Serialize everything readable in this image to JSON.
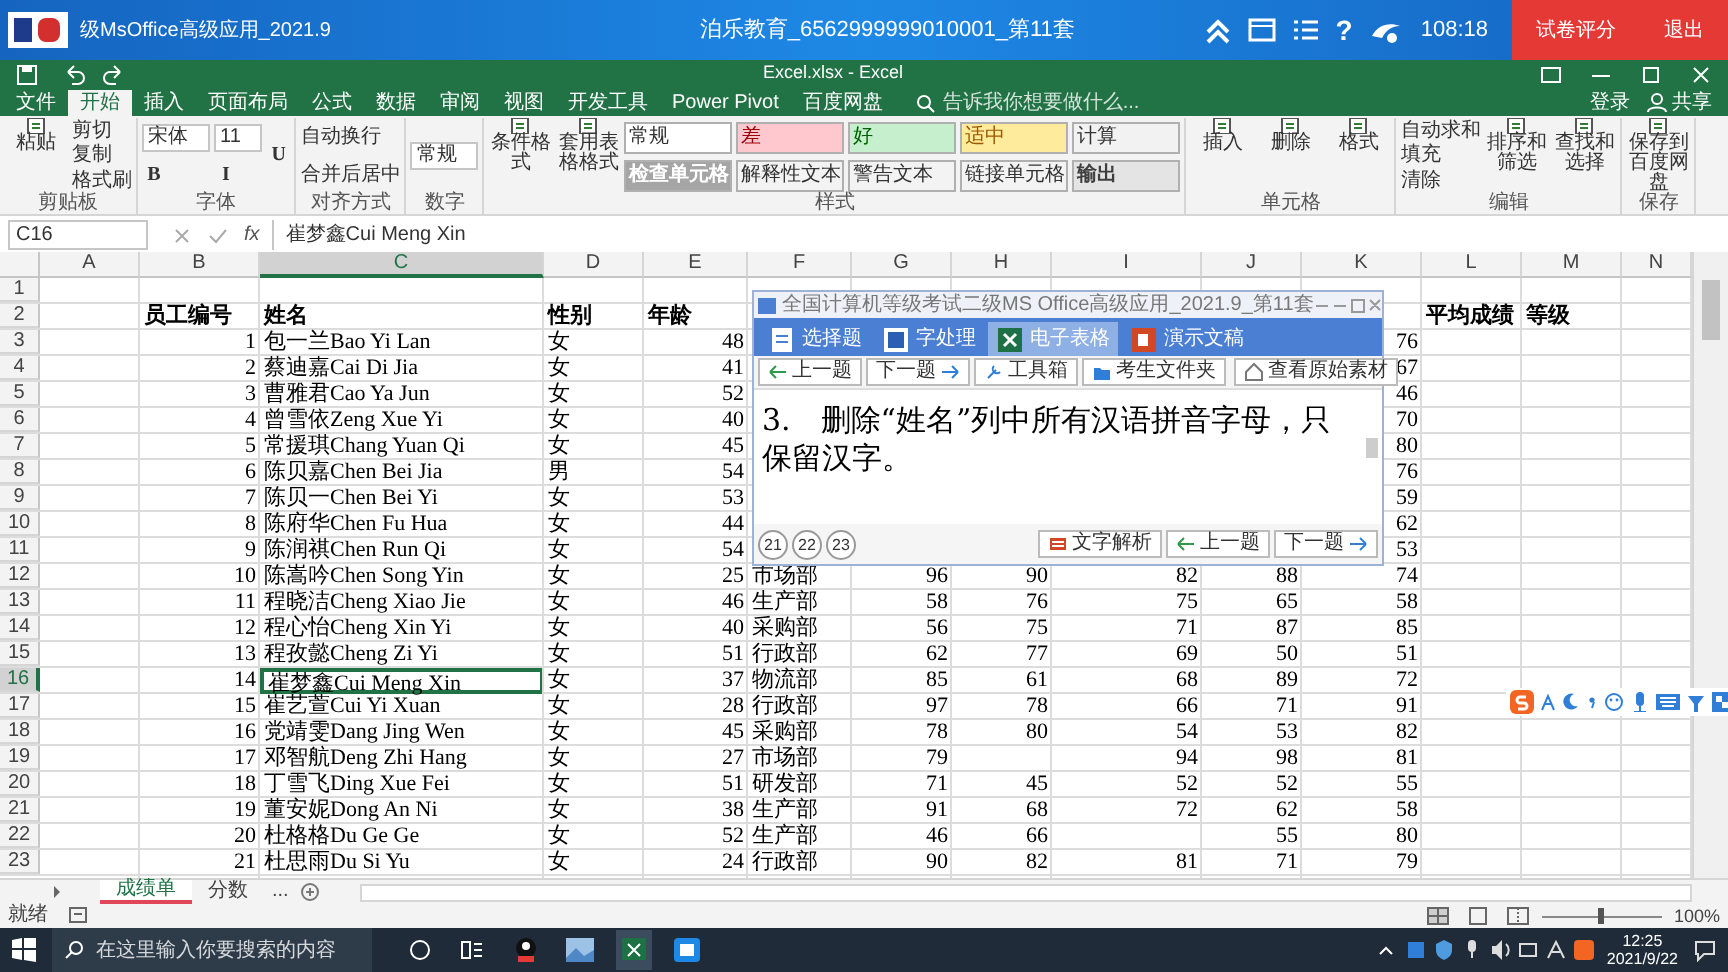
{
  "exam_bar": {
    "title": "级MsOffice高级应用_2021.9",
    "center": "泊乐教育_6562999999010001_第11套",
    "help": "?",
    "timer": "108:18",
    "buttons": [
      "试卷评分",
      "退出"
    ]
  },
  "excel_title": "Excel.xlsx - Excel",
  "ribbon_tabs": [
    {
      "label": "文件",
      "selected": false
    },
    {
      "label": "开始",
      "selected": true
    },
    {
      "label": "插入",
      "selected": false
    },
    {
      "label": "页面布局",
      "selected": false
    },
    {
      "label": "公式",
      "selected": false
    },
    {
      "label": "数据",
      "selected": false
    },
    {
      "label": "审阅",
      "selected": false
    },
    {
      "label": "视图",
      "selected": false
    },
    {
      "label": "开发工具",
      "selected": false
    },
    {
      "label": "Power Pivot",
      "selected": false
    },
    {
      "label": "百度网盘",
      "selected": false
    }
  ],
  "tell_me": "告诉我你想要做什么...",
  "account": [
    "登录",
    "共享"
  ],
  "ribbon_groups": [
    {
      "label": "剪贴板",
      "columns": [
        [
          {
            "kind": "large",
            "text": "粘贴"
          }
        ],
        [
          {
            "kind": "small",
            "text": "剪切"
          },
          {
            "kind": "small",
            "text": "复制"
          },
          {
            "kind": "small",
            "text": "格式刷"
          }
        ]
      ]
    },
    {
      "label": "字体",
      "columns": [
        [
          {
            "kind": "field",
            "text": "宋体"
          },
          {
            "kind": "glyph",
            "text": "B"
          }
        ],
        [
          {
            "kind": "field",
            "text": "11"
          },
          {
            "kind": "glyph",
            "text": "I"
          }
        ],
        [
          {
            "kind": "glyph",
            "text": "U"
          }
        ]
      ]
    },
    {
      "label": "对齐方式",
      "columns": [
        [
          {
            "kind": "small",
            "text": "自动换行"
          },
          {
            "kind": "small",
            "text": "合并后居中"
          }
        ]
      ]
    },
    {
      "label": "数字",
      "columns": [
        [
          {
            "kind": "field",
            "text": "常规"
          }
        ]
      ]
    },
    {
      "label": "样式",
      "columns": [
        [
          {
            "kind": "large",
            "text": "条件格式"
          }
        ],
        [
          {
            "kind": "large",
            "text": "套用表格格式"
          }
        ],
        [
          {
            "kind": "style",
            "text": "常规",
            "color": "#ffffff"
          },
          {
            "kind": "style",
            "text": "检查单元格",
            "color": "#a5a5a5"
          }
        ],
        [
          {
            "kind": "style",
            "text": "差",
            "color": "#ffc7ce"
          },
          {
            "kind": "style",
            "text": "解释性文本",
            "color": "#f3f3f3"
          }
        ],
        [
          {
            "kind": "style",
            "text": "好",
            "color": "#c6efce"
          },
          {
            "kind": "style",
            "text": "警告文本",
            "color": "#f3f3f3"
          }
        ],
        [
          {
            "kind": "style",
            "text": "适中",
            "color": "#ffeb9c"
          },
          {
            "kind": "style",
            "text": "链接单元格",
            "color": "#f3f3f3"
          }
        ],
        [
          {
            "kind": "style",
            "text": "计算",
            "color": "#f2f2f2"
          },
          {
            "kind": "style",
            "text": "输出",
            "color": "#e4e4e4"
          }
        ]
      ]
    },
    {
      "label": "单元格",
      "columns": [
        [
          {
            "kind": "large",
            "text": "插入"
          }
        ],
        [
          {
            "kind": "large",
            "text": "删除"
          }
        ],
        [
          {
            "kind": "large",
            "text": "格式"
          }
        ]
      ]
    },
    {
      "label": "编辑",
      "columns": [
        [
          {
            "kind": "small",
            "text": "自动求和"
          },
          {
            "kind": "small",
            "text": "填充"
          },
          {
            "kind": "small",
            "text": "清除"
          }
        ],
        [
          {
            "kind": "large",
            "text": "排序和筛选"
          }
        ],
        [
          {
            "kind": "large",
            "text": "查找和选择"
          }
        ]
      ]
    },
    {
      "label": "保存",
      "columns": [
        [
          {
            "kind": "large",
            "text": "保存到百度网盘"
          }
        ]
      ]
    }
  ],
  "formula_bar": {
    "name_box": "C16",
    "fx": "fx",
    "formula": "崔梦鑫Cui Meng Xin"
  },
  "columns": [
    {
      "label": "A",
      "selected": false
    },
    {
      "label": "B",
      "selected": false
    },
    {
      "label": "C",
      "selected": true
    },
    {
      "label": "D",
      "selected": false
    },
    {
      "label": "E",
      "selected": false
    },
    {
      "label": "F",
      "selected": false
    },
    {
      "label": "G",
      "selected": false
    },
    {
      "label": "H",
      "selected": false
    },
    {
      "label": "I",
      "selected": false
    },
    {
      "label": "J",
      "selected": false
    },
    {
      "label": "K",
      "selected": false
    },
    {
      "label": "L",
      "selected": false
    },
    {
      "label": "M",
      "selected": false
    },
    {
      "label": "N",
      "selected": false
    }
  ],
  "rows": [
    {
      "row": "1",
      "kind": "data",
      "selected": false
    },
    {
      "row": "2",
      "kind": "header",
      "selected": false,
      "B": "员工编号",
      "C": "姓名",
      "D": "性别",
      "E": "年龄",
      "L": "平均成绩",
      "M": "等级"
    },
    {
      "row": "3",
      "kind": "data",
      "selected": false,
      "B": "1",
      "C": "包一兰Bao Yi Lan",
      "D": "女",
      "E": "48",
      "K": "76"
    },
    {
      "row": "4",
      "kind": "data",
      "selected": false,
      "B": "2",
      "C": "蔡迪嘉Cai Di Jia",
      "D": "女",
      "E": "41",
      "K": "67"
    },
    {
      "row": "5",
      "kind": "data",
      "selected": false,
      "B": "3",
      "C": "曹雅君Cao Ya Jun",
      "D": "女",
      "E": "52",
      "K": "46"
    },
    {
      "row": "6",
      "kind": "data",
      "selected": false,
      "B": "4",
      "C": "曾雪依Zeng Xue Yi",
      "D": "女",
      "E": "40",
      "K": "70"
    },
    {
      "row": "7",
      "kind": "data",
      "selected": false,
      "B": "5",
      "C": "常援琪Chang Yuan Qi",
      "D": "女",
      "E": "45",
      "K": "80"
    },
    {
      "row": "8",
      "kind": "data",
      "selected": false,
      "B": "6",
      "C": "陈贝嘉Chen Bei Jia",
      "D": "男",
      "E": "54",
      "K": "76"
    },
    {
      "row": "9",
      "kind": "data",
      "selected": false,
      "B": "7",
      "C": "陈贝一Chen Bei Yi",
      "D": "女",
      "E": "53",
      "K": "59"
    },
    {
      "row": "10",
      "kind": "data",
      "selected": false,
      "B": "8",
      "C": "陈府华Chen Fu Hua",
      "D": "女",
      "E": "44",
      "K": "62"
    },
    {
      "row": "11",
      "kind": "data",
      "selected": false,
      "B": "9",
      "C": "陈润祺Chen Run Qi",
      "D": "女",
      "E": "54",
      "K": "53"
    },
    {
      "row": "12",
      "kind": "data",
      "selected": false,
      "B": "10",
      "C": "陈嵩吟Chen Song Yin",
      "D": "女",
      "E": "25",
      "F": "市场部",
      "G": "96",
      "H": "90",
      "I": "82",
      "J": "88",
      "K": "74"
    },
    {
      "row": "13",
      "kind": "data",
      "selected": false,
      "B": "11",
      "C": "程晓洁Cheng Xiao Jie",
      "D": "女",
      "E": "46",
      "F": "生产部",
      "G": "58",
      "H": "76",
      "I": "75",
      "J": "65",
      "K": "58"
    },
    {
      "row": "14",
      "kind": "data",
      "selected": false,
      "B": "12",
      "C": "程心怡Cheng Xin Yi",
      "D": "女",
      "E": "40",
      "F": "采购部",
      "G": "56",
      "H": "75",
      "I": "71",
      "J": "87",
      "K": "85"
    },
    {
      "row": "15",
      "kind": "data",
      "selected": false,
      "B": "13",
      "C": "程孜懿Cheng Zi Yi",
      "D": "女",
      "E": "51",
      "F": "行政部",
      "G": "62",
      "H": "77",
      "I": "69",
      "J": "50",
      "K": "51"
    },
    {
      "row": "16",
      "kind": "data",
      "selected": true,
      "B": "14",
      "C": "崔梦鑫Cui Meng Xin",
      "D": "女",
      "E": "37",
      "F": "物流部",
      "G": "85",
      "H": "61",
      "I": "68",
      "J": "89",
      "K": "72"
    },
    {
      "row": "17",
      "kind": "data",
      "selected": false,
      "B": "15",
      "C": "崔艺萱Cui Yi Xuan",
      "D": "女",
      "E": "28",
      "F": "行政部",
      "G": "97",
      "H": "78",
      "I": "66",
      "J": "71",
      "K": "91"
    },
    {
      "row": "18",
      "kind": "data",
      "selected": false,
      "B": "16",
      "C": "党靖雯Dang Jing Wen",
      "D": "女",
      "E": "45",
      "F": "采购部",
      "G": "78",
      "H": "80",
      "I": "54",
      "J": "53",
      "K": "82"
    },
    {
      "row": "19",
      "kind": "data",
      "selected": false,
      "B": "17",
      "C": "邓智航Deng Zhi Hang",
      "D": "女",
      "E": "27",
      "F": "市场部",
      "G": "79",
      "I": "94",
      "J": "98",
      "K": "81"
    },
    {
      "row": "20",
      "kind": "data",
      "selected": false,
      "B": "18",
      "C": "丁雪飞Ding Xue Fei",
      "D": "女",
      "E": "51",
      "F": "研发部",
      "G": "71",
      "H": "45",
      "I": "52",
      "J": "52",
      "K": "55"
    },
    {
      "row": "21",
      "kind": "data",
      "selected": false,
      "B": "19",
      "C": "董安妮Dong An Ni",
      "D": "女",
      "E": "38",
      "F": "生产部",
      "G": "91",
      "H": "68",
      "I": "72",
      "J": "62",
      "K": "58"
    },
    {
      "row": "22",
      "kind": "data",
      "selected": false,
      "B": "20",
      "C": "杜格格Du Ge Ge",
      "D": "女",
      "E": "52",
      "F": "生产部",
      "G": "46",
      "H": "66",
      "J": "55",
      "K": "80"
    },
    {
      "row": "23",
      "kind": "data",
      "selected": false,
      "B": "21",
      "C": "杜思雨Du Si Yu",
      "D": "女",
      "E": "24",
      "F": "行政部",
      "G": "90",
      "H": "82",
      "I": "81",
      "J": "71",
      "K": "79"
    }
  ],
  "dialog": {
    "title": "全国计算机等级考试二级MS Office高级应用_2021.9_第11套",
    "tabs": [
      {
        "label": "选择题",
        "selected": false
      },
      {
        "label": "字处理",
        "selected": false
      },
      {
        "label": "电子表格",
        "selected": true
      },
      {
        "label": "演示文稿",
        "selected": false
      }
    ],
    "toolbar": [
      "上一题",
      "下一题",
      "工具箱",
      "考生文件夹"
    ],
    "material_button": "查看原始素材",
    "question": "3.　删除“姓名”列中所有汉语拼音字母，只保留汉字。",
    "question_numbers": [
      "21",
      "22",
      "23"
    ],
    "footer_buttons": [
      "文字解析",
      "上一题",
      "下一题"
    ]
  },
  "sheet_tabs": [
    {
      "label": "成绩单",
      "selected": true
    },
    {
      "label": "分数",
      "selected": false
    }
  ],
  "more_tabs": "...",
  "status": "就绪",
  "zoom_slider": {
    "level": 0.5
  },
  "zoom": "100%",
  "taskbar": {
    "search_placeholder": "在这里输入你要搜索的内容",
    "time": "12:25",
    "date": "2021/9/22"
  }
}
